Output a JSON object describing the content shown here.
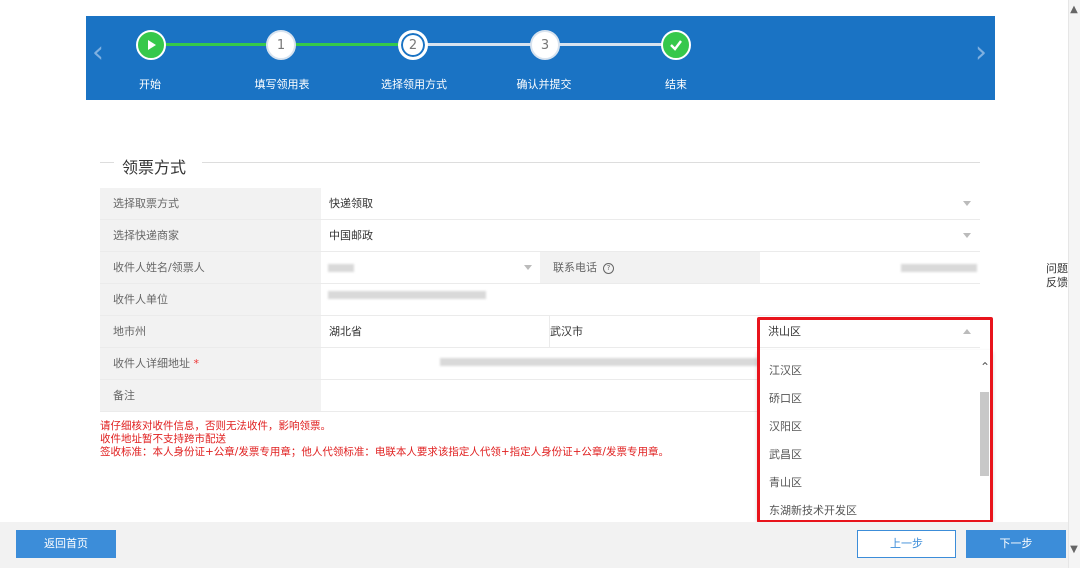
{
  "steps": [
    {
      "label": "开始",
      "number": "",
      "state": "done",
      "icon": "play-icon"
    },
    {
      "label": "填写领用表",
      "number": "1",
      "state": "todo"
    },
    {
      "label": "选择领用方式",
      "number": "2",
      "state": "current"
    },
    {
      "label": "确认并提交",
      "number": "3",
      "state": "todo"
    },
    {
      "label": "结束",
      "number": "",
      "state": "done",
      "icon": "check-icon"
    }
  ],
  "nav": {
    "prev_icon": "chevron-left-icon",
    "next_icon": "chevron-right-icon",
    "prev_glyph": "‹",
    "next_glyph": "›"
  },
  "section": {
    "title": "领票方式"
  },
  "form": {
    "pickup_method": {
      "label": "选择取票方式",
      "value": "快递领取"
    },
    "courier": {
      "label": "选择快递商家",
      "value": "中国邮政"
    },
    "recipient_name": {
      "label": "收件人姓名/领票人",
      "value": ""
    },
    "phone": {
      "label": "联系电话",
      "help_glyph": "?"
    },
    "recipient_unit": {
      "label": "收件人单位",
      "value": ""
    },
    "region": {
      "label": "地市州",
      "province": "湖北省",
      "city": "武汉市",
      "district": "洪山区"
    },
    "address": {
      "label": "收件人详细地址",
      "required_mark": "*",
      "value": ""
    },
    "remarks": {
      "label": "备注",
      "value": ""
    }
  },
  "notes": [
    "请仔细核对收件信息，否则无法收件，影响领票。",
    "收件地址暂不支持跨市配送",
    "签收标准：本人身份证+公章/发票专用章；他人代领标准：电联本人要求该指定人代领+指定人身份证+公章/发票专用章。"
  ],
  "district_options": [
    "江汉区",
    "硚口区",
    "汉阳区",
    "武昌区",
    "青山区",
    "东湖新技术开发区"
  ],
  "feedback": {
    "line1": "问题",
    "line2": "反馈"
  },
  "footer": {
    "home": "返回首页",
    "prev": "上一步",
    "next": "下一步"
  },
  "colors": {
    "banner": "#1a73c4",
    "step_done": "#36c84b",
    "highlight": "#e8141c",
    "button": "#3c8dd9",
    "note": "#e02020"
  }
}
